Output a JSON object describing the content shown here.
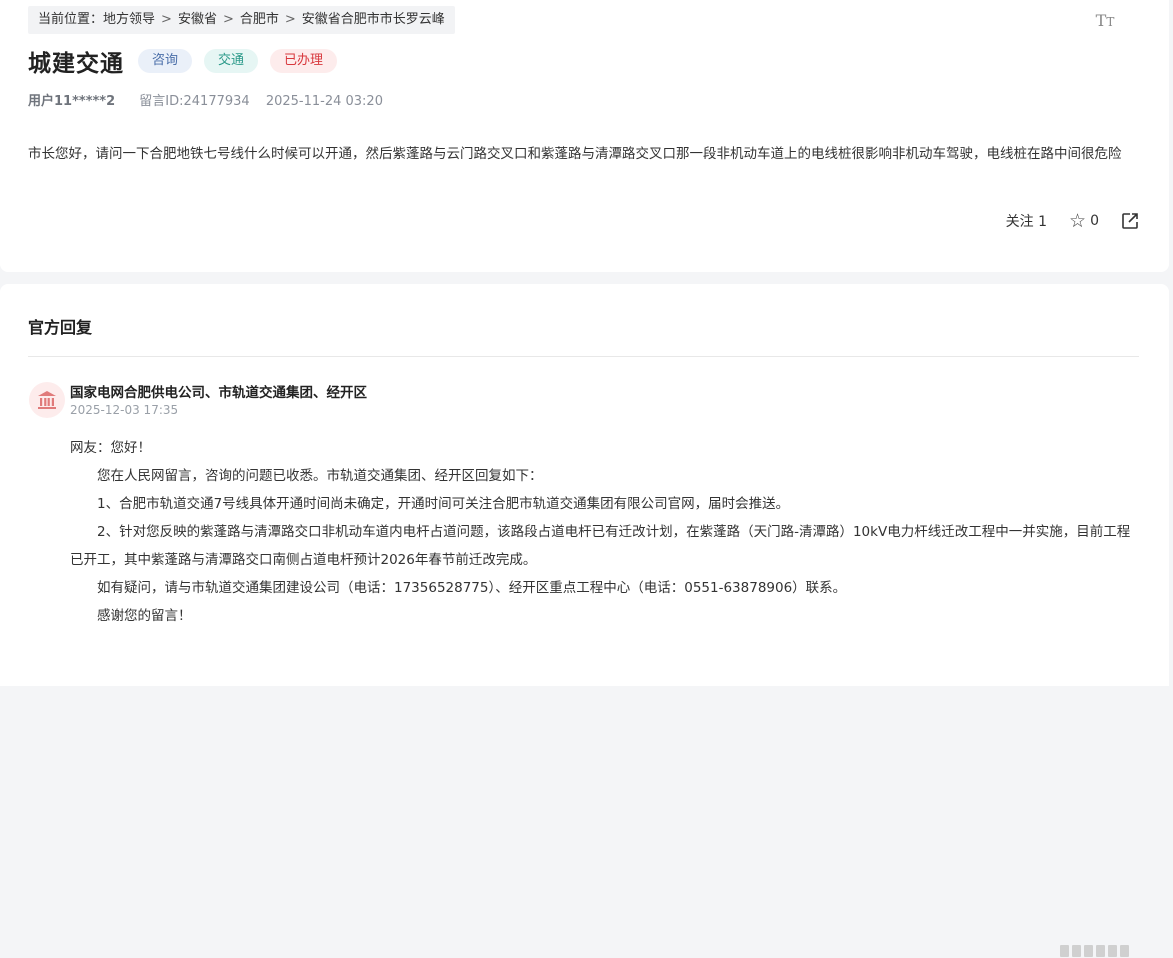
{
  "breadcrumb": {
    "prefix": "当前位置：",
    "items": [
      "地方领导",
      "安徽省",
      "合肥市",
      "安徽省合肥市市长罗云峰"
    ],
    "separator": ">"
  },
  "font_size_toggle": {
    "icon": "text-size-icon",
    "label_big": "T",
    "label_small": "T"
  },
  "message": {
    "title": "城建交通",
    "tags": [
      {
        "label": "咨询",
        "color": "#4a6ea9"
      },
      {
        "label": "交通",
        "color": "#2b9a8a"
      },
      {
        "label": "已办理",
        "color": "#d8383d"
      }
    ],
    "user": "用户11*****2",
    "message_id": "留言ID:24177934",
    "time": "2025-11-24 03:20",
    "content": "市长您好，请问一下合肥地铁七号线什么时候可以开通，然后紫蓬路与云门路交叉口和紫蓬路与清潭路交叉口那一段非机动车道上的电线桩很影响非机动车驾驶，电线桩在路中间很危险",
    "follow_label": "关注",
    "follow_count": "1",
    "star_count": "0"
  },
  "reply": {
    "heading": "官方回复",
    "org": "国家电网合肥供电公司、市轨道交通集团、经开区",
    "time": "2025-12-03 17:35",
    "paragraphs": [
      "网友：您好！",
      "您在人民网留言，咨询的问题已收悉。市轨道交通集团、经开区回复如下：",
      "1、合肥市轨道交通7号线具体开通时间尚未确定，开通时间可关注合肥市轨道交通集团有限公司官网，届时会推送。",
      "2、针对您反映的紫蓬路与清潭路交口非机动车道内电杆占道问题，该路段占道电杆已有迁改计划，在紫蓬路（天门路-清潭路）10kV电力杆线迁改工程中一并实施，目前工程已开工，其中紫蓬路与清潭路交口南侧占道电杆预计2026年春节前迁改完成。",
      "如有疑问，请与市轨道交通集团建设公司（电话：17356528775）、经开区重点工程中心（电话：0551-63878906）联系。",
      "感谢您的留言！"
    ]
  },
  "colors": {
    "accent": "#d8383d",
    "background": "#f4f5f7"
  }
}
